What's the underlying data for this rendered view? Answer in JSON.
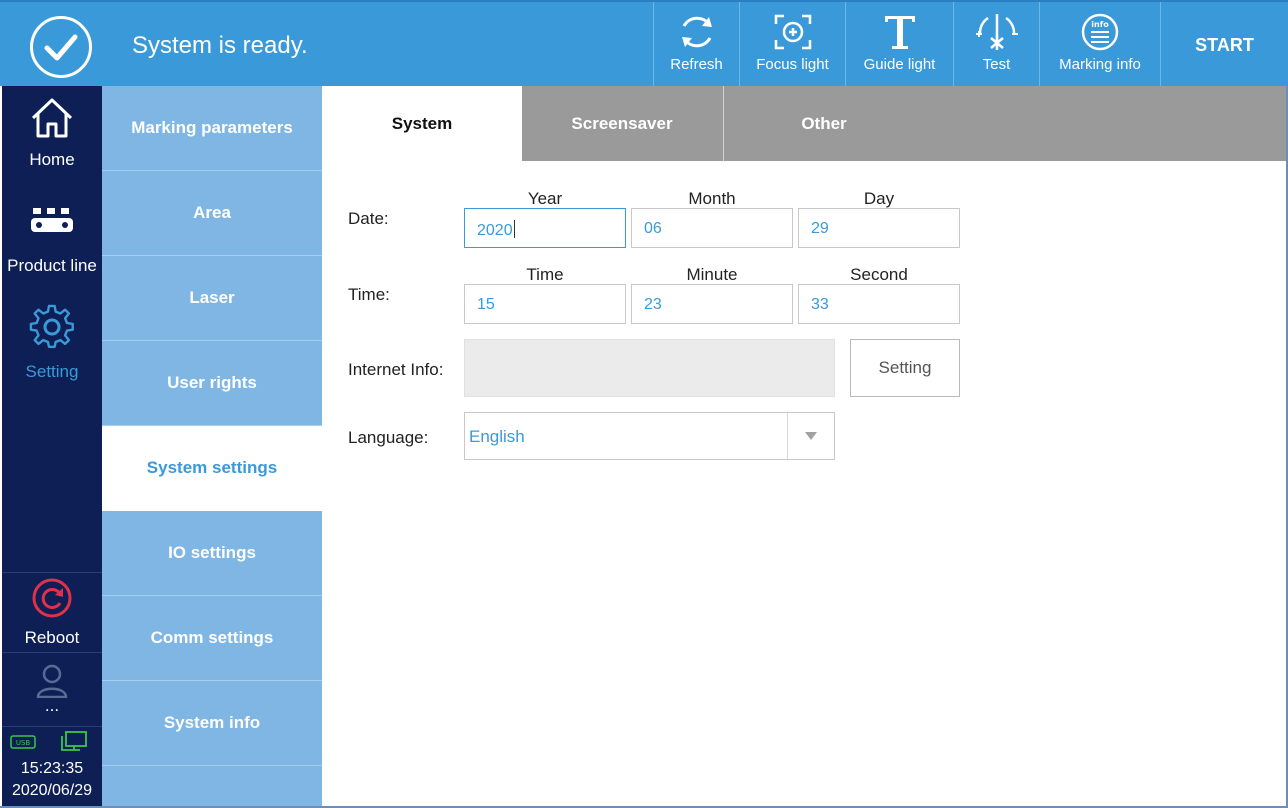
{
  "topbar": {
    "status": "System is ready.",
    "buttons": {
      "refresh": "Refresh",
      "focus_light": "Focus light",
      "guide_light": "Guide light",
      "test": "Test",
      "marking_info": "Marking info"
    },
    "start": "START"
  },
  "leftnav": {
    "home": "Home",
    "product_line": "Product line",
    "setting": "Setting",
    "reboot": "Reboot",
    "user": "...",
    "time": "15:23:35",
    "date": "2020/06/29"
  },
  "submenu": {
    "items": [
      "Marking parameters",
      "Area",
      "Laser",
      "User rights",
      "System settings",
      "IO settings",
      "Comm settings",
      "System info"
    ]
  },
  "tabs": [
    "System",
    "Screensaver",
    "Other"
  ],
  "form": {
    "date_label": "Date:",
    "time_label": "Time:",
    "internet_label": "Internet Info:",
    "language_label": "Language:",
    "date_cols": [
      "Year",
      "Month",
      "Day"
    ],
    "time_cols": [
      "Time",
      "Minute",
      "Second"
    ],
    "year": "2020",
    "month": "06",
    "day": "29",
    "hour": "15",
    "minute": "23",
    "second": "33",
    "setting_button": "Setting",
    "language_value": "English"
  },
  "colors": {
    "accent": "#3a9ad9",
    "nav_bg": "#0e1f55",
    "submenu_bg": "#7fb6e3",
    "tab_bg": "#9a9a9a",
    "reboot": "#e0304a"
  }
}
